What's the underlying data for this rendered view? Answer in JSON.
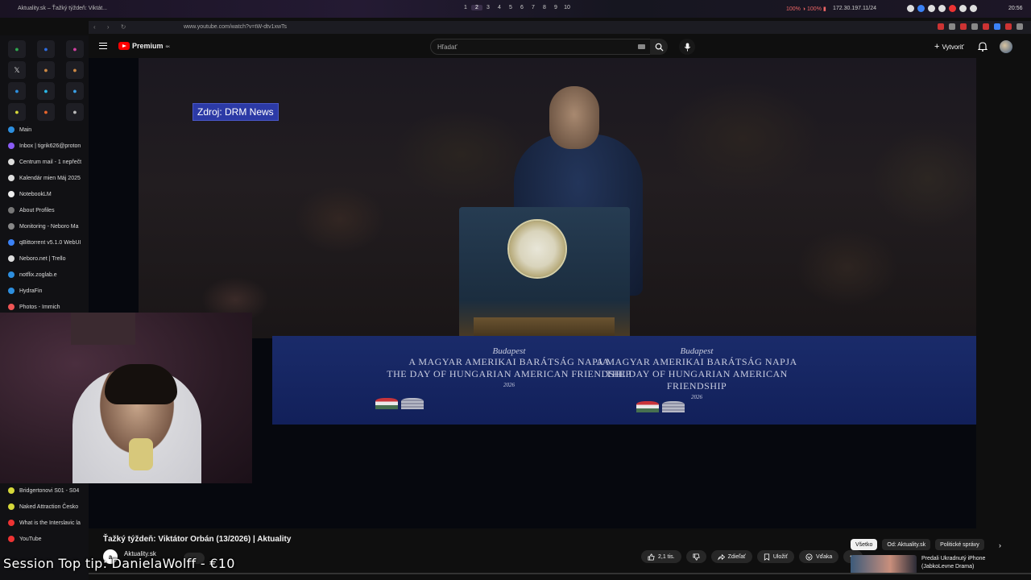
{
  "os_bar": {
    "tab_title": "Aktuality.sk – Ťažký týždeň: Viktát...",
    "workspaces": [
      "1",
      "2",
      "3",
      "4",
      "5",
      "6",
      "7",
      "8",
      "9",
      "10"
    ],
    "active_workspace": "2",
    "stats": "100% ◑ 100% ▮",
    "ip": "172.30.197.11/24",
    "clock": "20:56"
  },
  "browser": {
    "url": "www.youtube.com/watch?v=tW-dtv1xwTs",
    "nav_glyphs": "‹ › ↻"
  },
  "sidebar": {
    "apps": [
      "●",
      "●",
      "●",
      "𝕏",
      "●",
      "●",
      "●",
      "●",
      "●",
      "●",
      "●",
      "●"
    ],
    "app_colors": [
      "#2fa84f",
      "#2d6cdf",
      "#d03fa0",
      "#ddd",
      "#c84",
      "#c84",
      "#2d8fdf",
      "#29b8e8",
      "#3ba0e6",
      "#d6d83a",
      "#e8642c",
      "#bbb"
    ],
    "bookmarks": [
      {
        "label": "Main",
        "color": "#2d8fdf"
      },
      {
        "label": "Inbox | tigrik626@proton",
        "color": "#8a5cf5"
      },
      {
        "label": "Centrum mail - 1 nepřečt",
        "color": "#ddd"
      },
      {
        "label": "Kalendár mien Máj 2025",
        "color": "#ddd"
      },
      {
        "label": "NotebookLM",
        "color": "#eee"
      },
      {
        "label": "About Profiles",
        "color": "#777"
      },
      {
        "label": "Monitoring - Neboro Ma",
        "color": "#888"
      },
      {
        "label": "qBittorrent v5.1.0 WebUI",
        "color": "#3b82f6"
      },
      {
        "label": "Neboro.net | Trello",
        "color": "#ddd"
      },
      {
        "label": "notflix.zoglab.e",
        "color": "#2d8fdf"
      },
      {
        "label": "HydraFin",
        "color": "#2d8fdf"
      },
      {
        "label": "Photos - Immich",
        "color": "#e55"
      }
    ],
    "bookmarks_bottom": [
      {
        "label": "Bridgertonovi S01 - S04",
        "color": "#d6d83a"
      },
      {
        "label": "Naked Attraction Česko",
        "color": "#d6d83a"
      },
      {
        "label": "What is the Interslavic la",
        "color": "#e33"
      },
      {
        "label": "YouTube",
        "color": "#e33"
      }
    ]
  },
  "youtube_header": {
    "logo_text": "Premium",
    "logo_region": "SK",
    "search_placeholder": "Hľadať",
    "create_label": "Vytvoriť",
    "create_plus": "+"
  },
  "video": {
    "source_label": "Zdroj: DRM News",
    "banner_city": "Budapest",
    "banner_line1": "A MAGYAR AMERIKAI BARÁTSÁG NAPJA",
    "banner_line2": "THE DAY OF HUNGARIAN AMERICAN FRIENDSHIP",
    "banner_year": "2026"
  },
  "below_player": {
    "title": "Ťažký týždeň: Viktátor Orbán (13/2026) | Aktuality",
    "channel_avatar_text": "a",
    "channel_name": "Aktuality.sk",
    "channel_subs": "",
    "like_count": "2,1 tis.",
    "share_label": "Zdieľať",
    "save_label": "Uložiť",
    "thanks_label": "Vďaka",
    "more_label": "•••",
    "chips": [
      "Všetko",
      "Od: Aktuality.sk",
      "Politické správy"
    ],
    "chips_next": "›",
    "rec_title": "Predali Ukradnutý iPhone (JabkoLevne Drama)",
    "rec_more": "⋮"
  },
  "overlay": {
    "top_tip": "Session Top tip: DanielaWolff - €10"
  }
}
